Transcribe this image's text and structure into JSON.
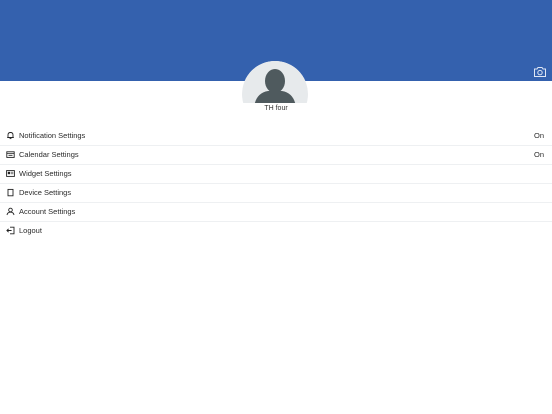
{
  "profile": {
    "name": "TH four"
  },
  "colors": {
    "header": "#3461ae",
    "avatar_bg": "#e7eaec",
    "avatar_figure": "#4f5a5e"
  },
  "menu": [
    {
      "icon": "bell-icon",
      "label": "Notification Settings",
      "value": "On"
    },
    {
      "icon": "calendar-icon",
      "label": "Calendar Settings",
      "value": "On"
    },
    {
      "icon": "widget-icon",
      "label": "Widget Settings",
      "value": ""
    },
    {
      "icon": "device-icon",
      "label": "Device Settings",
      "value": ""
    },
    {
      "icon": "user-icon",
      "label": "Account Settings",
      "value": ""
    },
    {
      "icon": "logout-icon",
      "label": "Logout",
      "value": ""
    }
  ]
}
